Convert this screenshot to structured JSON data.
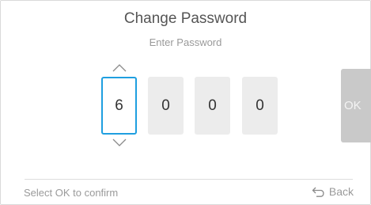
{
  "dialog": {
    "title": "Change Password",
    "subtitle": "Enter Password"
  },
  "digits": [
    {
      "value": "6",
      "selected": true
    },
    {
      "value": "0",
      "selected": false
    },
    {
      "value": "0",
      "selected": false
    },
    {
      "value": "0",
      "selected": false
    }
  ],
  "controls": {
    "increment_icon": "chevron-up-icon",
    "decrement_icon": "chevron-down-icon",
    "ok_label": "OK"
  },
  "footer": {
    "hint": "Select OK to confirm",
    "back_label": "Back",
    "back_icon": "return-arrow-icon"
  },
  "colors": {
    "accent": "#1f9fe0",
    "digit_bg": "#ececec",
    "ok_bg": "#c9c9c9",
    "muted_text": "#9a9a9a"
  }
}
